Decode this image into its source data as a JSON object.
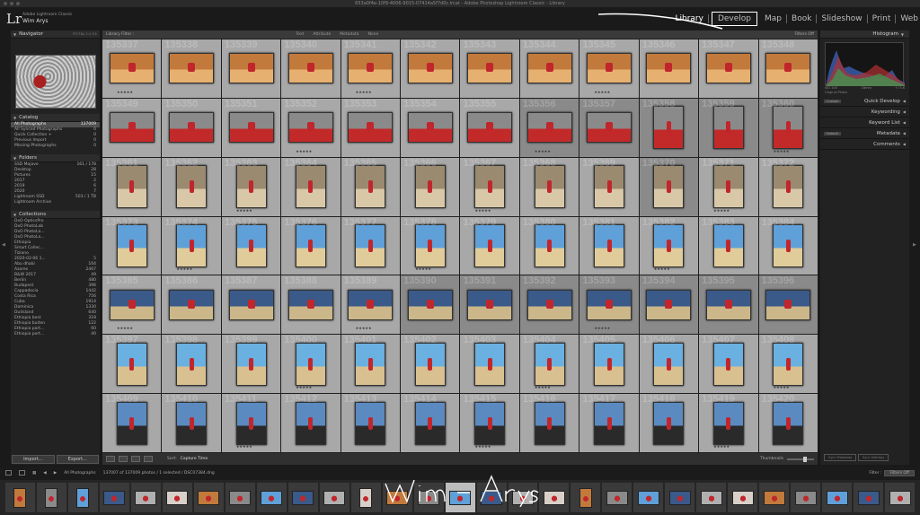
{
  "window": {
    "title": "653a0f4e-10f9-4006-9015-07414a5f7d0c.lrcat - Adobe Photoshop Lightroom Classic - Library"
  },
  "identity": {
    "app": "Adobe Lightroom Classic",
    "user": "Wim Arys",
    "logo": "Lr"
  },
  "modules": [
    {
      "label": "Library",
      "active": true
    },
    {
      "label": "Develop",
      "selected": true
    },
    {
      "label": "Map"
    },
    {
      "label": "Book"
    },
    {
      "label": "Slideshow"
    },
    {
      "label": "Print"
    },
    {
      "label": "Web"
    }
  ],
  "left_panel": {
    "navigator": {
      "title": "Navigator",
      "zoom_opts": "FIT  FILL  1:1  3:1"
    },
    "catalog": {
      "title": "Catalog",
      "items": [
        {
          "label": "All Photographs",
          "count": "137009",
          "selected": true
        },
        {
          "label": "All Synced Photographs",
          "count": "0"
        },
        {
          "label": "Quick Collection +",
          "count": "0"
        },
        {
          "label": "Previous Import",
          "count": "0"
        },
        {
          "label": "Missing Photographs",
          "count": "0"
        }
      ]
    },
    "folders": {
      "title": "Folders",
      "items": [
        {
          "label": "SSD Mojave",
          "count": "161 / 178"
        },
        {
          "label": "Desktop",
          "count": "28"
        },
        {
          "label": "Pictures",
          "count": "15"
        },
        {
          "label": "2017",
          "count": "2"
        },
        {
          "label": "2019",
          "count": "6"
        },
        {
          "label": "2020",
          "count": "7"
        },
        {
          "label": "Lightroom SSD",
          "count": "503 / 1 TB"
        },
        {
          "label": "Lightroom Archive",
          "count": ""
        }
      ]
    },
    "collections": {
      "title": "Collections",
      "items": [
        {
          "label": "DxO OpticsPro",
          "count": ""
        },
        {
          "label": "DxO PhotoLab",
          "count": ""
        },
        {
          "label": "DxO PhotoLa...",
          "count": ""
        },
        {
          "label": "DxO PhotoLa...",
          "count": ""
        },
        {
          "label": "Ethiopia",
          "count": ""
        },
        {
          "label": "Smart Collec...",
          "count": ""
        },
        {
          "label": "Tiziano",
          "count": ""
        },
        {
          "label": "2020-02-06 1...",
          "count": "5"
        },
        {
          "label": "Abu dhabi",
          "count": "164"
        },
        {
          "label": "Azores",
          "count": "2467"
        },
        {
          "label": "B&W 2017",
          "count": "49"
        },
        {
          "label": "Berlin",
          "count": "480"
        },
        {
          "label": "Budapest",
          "count": "396"
        },
        {
          "label": "Cappadocia",
          "count": "1442"
        },
        {
          "label": "Costa Rica",
          "count": "756"
        },
        {
          "label": "Cuba",
          "count": "1914"
        },
        {
          "label": "Dominica",
          "count": "1330"
        },
        {
          "label": "Duitsland",
          "count": "640"
        },
        {
          "label": "Ethiopia best",
          "count": "318"
        },
        {
          "label": "Ethiopia buiten",
          "count": "122"
        },
        {
          "label": "Ethiopia port...",
          "count": "60"
        },
        {
          "label": "Ethiopia port...",
          "count": "40"
        }
      ]
    },
    "import_label": "Import...",
    "export_label": "Export..."
  },
  "filter_bar": {
    "title": "Library Filter :",
    "options": [
      "Text",
      "Attribute",
      "Metadata",
      "None"
    ],
    "active": "None",
    "filters_off": "Filters Off"
  },
  "grid": {
    "rows": [
      [
        "135337",
        "135338",
        "135339",
        "135340",
        "135341",
        "135342",
        "135343",
        "135344",
        "135345",
        "135346",
        "135347",
        "135348"
      ],
      [
        "135349",
        "135350",
        "135351",
        "135352",
        "135353",
        "135354",
        "135355",
        "135356",
        "135357",
        "135358",
        "135359",
        "135360"
      ],
      [
        "135361",
        "135362",
        "135363",
        "135364",
        "135365",
        "135366",
        "135367",
        "135368",
        "135369",
        "135370",
        "135371",
        "135372"
      ],
      [
        "135373",
        "135374",
        "135375",
        "135376",
        "135377",
        "135378",
        "135379",
        "135380",
        "135381",
        "135382",
        "135383",
        "135384"
      ],
      [
        "135385",
        "135386",
        "135387",
        "135388",
        "135389",
        "135390",
        "135391",
        "135392",
        "135393",
        "135394",
        "135395",
        "135396"
      ],
      [
        "135397",
        "135398",
        "135399",
        "135400",
        "135401",
        "135402",
        "135403",
        "135404",
        "135405",
        "135406",
        "135407",
        "135408"
      ],
      [
        "135409",
        "135410",
        "135411",
        "135412",
        "135413",
        "135414",
        "135415",
        "135416",
        "135417",
        "135418",
        "135419",
        "135420"
      ]
    ]
  },
  "toolbar": {
    "sort_label": "Sort:",
    "sort_value": "Capture Time",
    "thumbnails_label": "Thumbnails"
  },
  "right_panel": {
    "histogram": {
      "title": "Histogram",
      "info_left": "ISO 100",
      "info_mid": "18mm",
      "info_right": "f / 5.6"
    },
    "original_photo": "Original Photo",
    "quick_develop": {
      "preset": "Custom",
      "title": "Quick Develop"
    },
    "keywording": "Keywording",
    "keyword_list": "Keyword List",
    "metadata": {
      "preset": "Default",
      "title": "Metadata"
    },
    "comments": "Comments",
    "sync_metadata": "Sync Metadata",
    "sync_settings": "Sync Settings"
  },
  "filmstrip_bar": {
    "source": "All Photographs",
    "status": "137007 of 137009 photos / 1 selected / DSC07384.dng",
    "filter_label": "Filter :",
    "filter_value": "Filters Off"
  },
  "watermark": "Wim Arys",
  "colors": {
    "accent_red": "#c0262c",
    "sky": "#6fb0de",
    "sand": "#d9c9a0",
    "panel": "#222222",
    "grid_cell": "#a8a8a8"
  }
}
